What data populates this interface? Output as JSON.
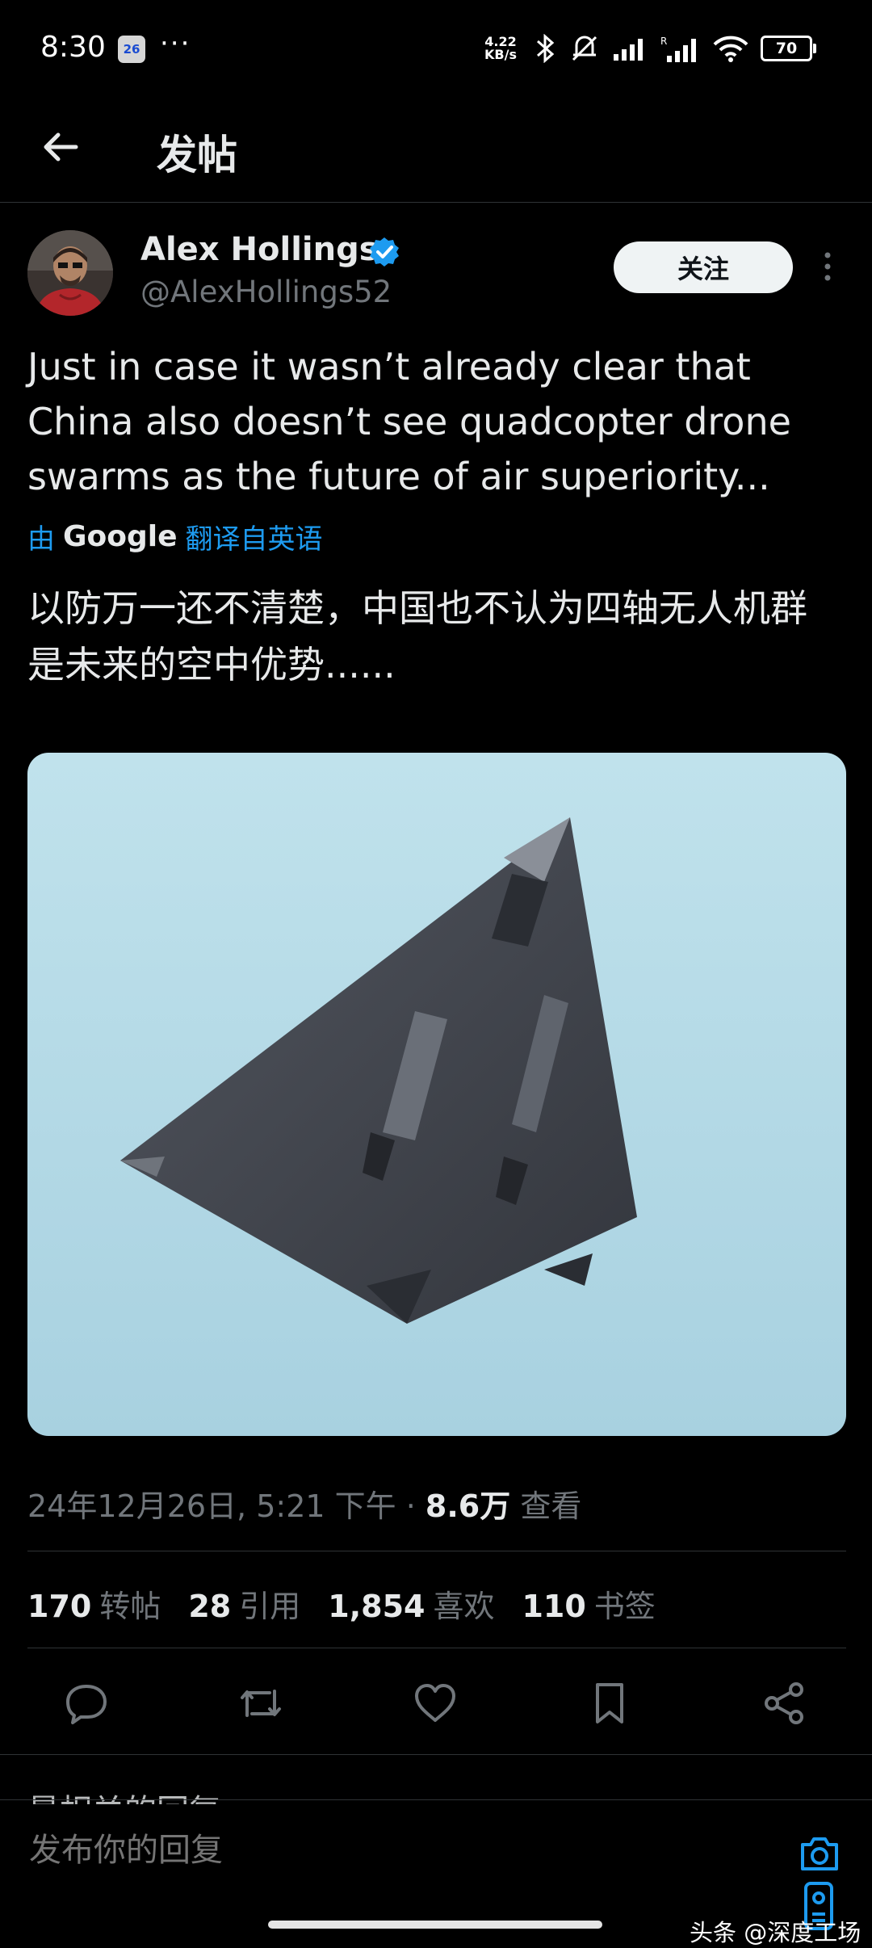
{
  "status_bar": {
    "time": "8:30",
    "date_badge": "26",
    "more": "···",
    "speed_value": "4.22",
    "speed_unit": "KB/s",
    "battery": "70"
  },
  "header": {
    "title": "发帖"
  },
  "author": {
    "name": "Alex Hollings",
    "handle": "@AlexHollings52",
    "follow_label": "关注"
  },
  "tweet": {
    "text": "Just in case it wasn’t already clear that China also doesn’t see quadcopter drone swarms as the future of air superiority...",
    "translate_prefix": "由",
    "translate_brand": "Google",
    "translate_suffix": "翻译自英语",
    "translated_text": "以防万一还不清楚，中国也不认为四轴无人机群是未来的空中优势......"
  },
  "meta": {
    "date": "24年12月26日, 5:21 下午 ·",
    "views": "8.6万",
    "views_label": "查看"
  },
  "stats": [
    {
      "value": "170",
      "label": "转帖"
    },
    {
      "value": "28",
      "label": "引用"
    },
    {
      "value": "1,854",
      "label": "喜欢"
    },
    {
      "value": "110",
      "label": "书签"
    }
  ],
  "actions": [
    "reply-icon",
    "retweet-icon",
    "like-icon",
    "bookmark-icon",
    "share-icon"
  ],
  "reply": {
    "hidden_heading": "最相关的回复",
    "placeholder": "发布你的回复"
  },
  "watermark": "头条 @深度工场",
  "colors": {
    "accent": "#1d9bf0",
    "background": "#000000",
    "muted": "#71767b"
  }
}
